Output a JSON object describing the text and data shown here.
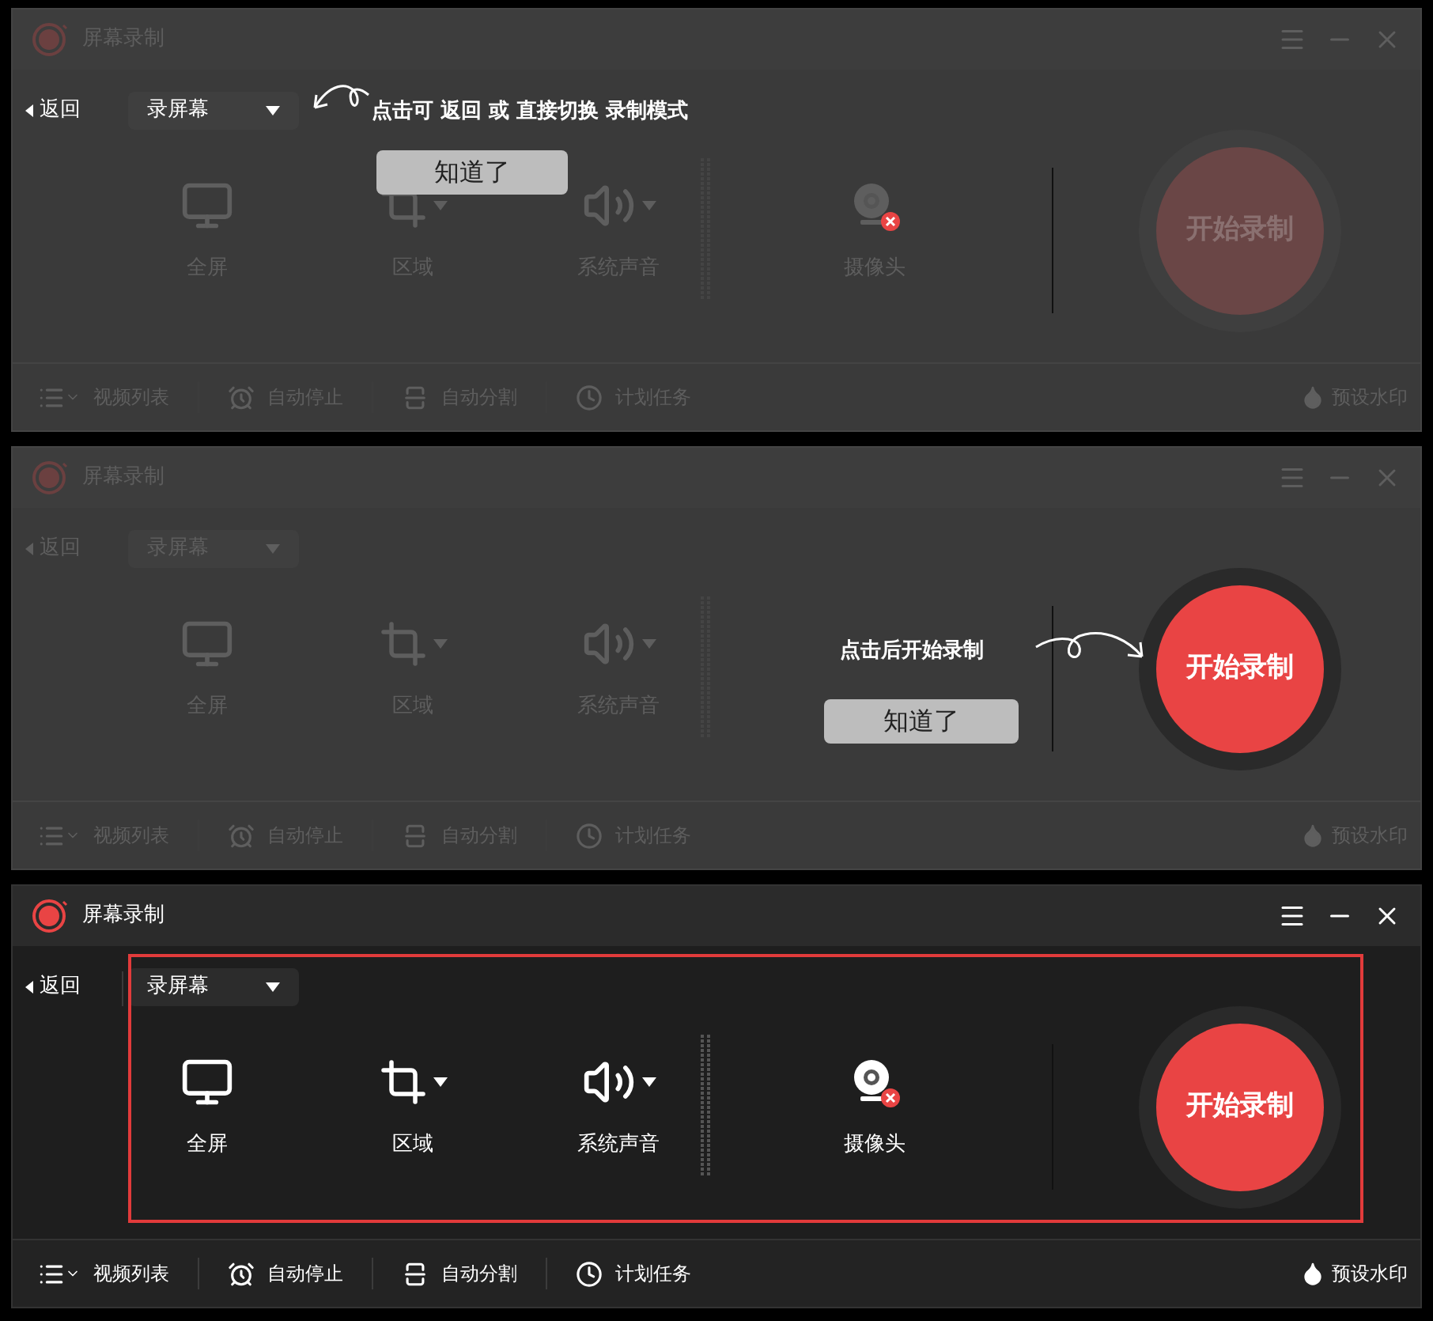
{
  "panels": [
    {
      "dimmed": true,
      "mode_spotlit": true,
      "start_spotlit": false,
      "outlined": false,
      "window": {
        "title": "屏幕录制"
      },
      "back": "返回",
      "mode": "录屏幕",
      "sources": [
        {
          "kind": "monitor",
          "label": "全屏",
          "dropdown": false
        },
        {
          "kind": "crop",
          "label": "区域",
          "dropdown": true
        },
        {
          "kind": "speaker",
          "label": "系统声音",
          "dropdown": true
        },
        {
          "kind": "camera",
          "label": "摄像头",
          "dropdown": false
        }
      ],
      "start": "开始录制",
      "footer": [
        {
          "kind": "list",
          "label": "视频列表"
        },
        {
          "kind": "alarm",
          "label": "自动停止"
        },
        {
          "kind": "split",
          "label": "自动分割"
        },
        {
          "kind": "clock",
          "label": "计划任务"
        }
      ],
      "watermark": "预设水印",
      "tip": {
        "kind": "mode",
        "text": "点击可 返回 或 直接切换 录制模式",
        "button": "知道了"
      }
    },
    {
      "dimmed": true,
      "mode_spotlit": false,
      "start_spotlit": true,
      "outlined": false,
      "window": {
        "title": "屏幕录制"
      },
      "back": "返回",
      "mode": "录屏幕",
      "sources": [
        {
          "kind": "monitor",
          "label": "全屏",
          "dropdown": false
        },
        {
          "kind": "crop",
          "label": "区域",
          "dropdown": true
        },
        {
          "kind": "speaker",
          "label": "系统声音",
          "dropdown": true
        }
      ],
      "start": "开始录制",
      "footer": [
        {
          "kind": "list",
          "label": "视频列表"
        },
        {
          "kind": "alarm",
          "label": "自动停止"
        },
        {
          "kind": "split",
          "label": "自动分割"
        },
        {
          "kind": "clock",
          "label": "计划任务"
        }
      ],
      "watermark": "预设水印",
      "tip": {
        "kind": "start",
        "text": "点击后开始录制",
        "button": "知道了"
      }
    },
    {
      "dimmed": false,
      "outlined": true,
      "window": {
        "title": "屏幕录制"
      },
      "back": "返回",
      "mode": "录屏幕",
      "sources": [
        {
          "kind": "monitor",
          "label": "全屏",
          "dropdown": false
        },
        {
          "kind": "crop",
          "label": "区域",
          "dropdown": true
        },
        {
          "kind": "speaker",
          "label": "系统声音",
          "dropdown": true
        },
        {
          "kind": "camera",
          "label": "摄像头",
          "dropdown": false
        }
      ],
      "start": "开始录制",
      "footer": [
        {
          "kind": "list",
          "label": "视频列表"
        },
        {
          "kind": "alarm",
          "label": "自动停止"
        },
        {
          "kind": "split",
          "label": "自动分割"
        },
        {
          "kind": "clock",
          "label": "计划任务"
        }
      ],
      "watermark": "预设水印"
    }
  ]
}
